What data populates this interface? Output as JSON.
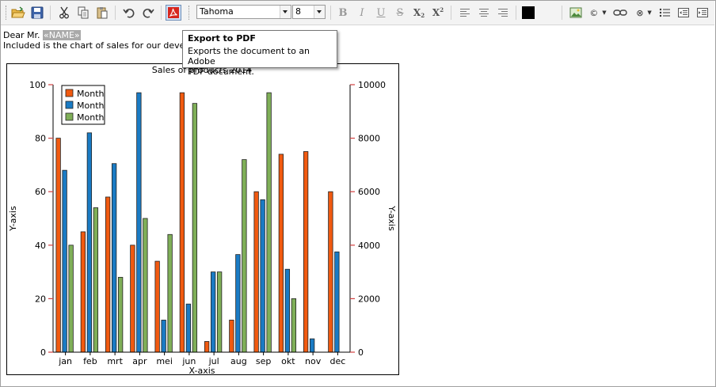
{
  "toolbar": {
    "font_name": "Tahoma",
    "font_size": "8",
    "color_swatch": "#000000"
  },
  "document": {
    "greeting": "Dear Mr.",
    "merge_field": "«NAME»",
    "intro": "Included is the chart of sales for our developm"
  },
  "tooltip": {
    "title": "Export to PDF",
    "body_line1": "Exports the document to an Adobe",
    "body_line2": "PDF document."
  },
  "chart_data": {
    "type": "bar",
    "title": "Sales of products 2014",
    "xlabel": "X-axis",
    "ylabel": "Y-axis",
    "y2label": "Y-axis",
    "categories": [
      "jan",
      "feb",
      "mrt",
      "apr",
      "mei",
      "jun",
      "jul",
      "aug",
      "sep",
      "okt",
      "nov",
      "dec"
    ],
    "series": [
      {
        "name": "Month",
        "color": "#f15a10",
        "axis": "left",
        "values": [
          80,
          45,
          58,
          40,
          34,
          97,
          4,
          12,
          60,
          74,
          75,
          60
        ]
      },
      {
        "name": "Month",
        "color": "#1a7bc4",
        "axis": "right",
        "values": [
          6800,
          8200,
          7050,
          9700,
          1200,
          1800,
          3000,
          3650,
          5700,
          3100,
          500,
          3750
        ]
      },
      {
        "name": "Month",
        "color": "#7faf58",
        "axis": "left",
        "values": [
          40,
          54,
          28,
          50,
          44,
          93,
          30,
          72,
          97,
          20,
          0,
          0
        ]
      }
    ],
    "ylim": [
      0,
      100
    ],
    "y2lim": [
      0,
      10000
    ],
    "yticks": [
      0,
      20,
      40,
      60,
      80,
      100
    ],
    "y2ticks": [
      0,
      2000,
      4000,
      6000,
      8000,
      10000
    ],
    "grid": false,
    "legend_position": "top-left"
  }
}
